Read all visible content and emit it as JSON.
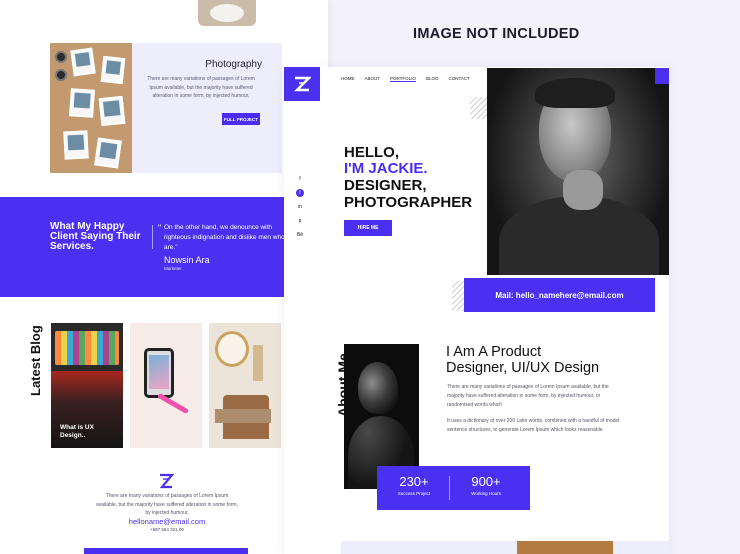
{
  "banner": {
    "text": "IMAGE NOT INCLUDED"
  },
  "left_page": {
    "project": {
      "title": "Photography",
      "text": "There are many variations of passages of Lorem Ipsum available, but the majority have suffered alteration in some form, by injected humour,",
      "button": "FULL PROJECT"
    },
    "testimonial": {
      "heading": "What My Happy Client Saying Their Services.",
      "quote": "On the other hand, we denounce with righteous indignation and dislike men who are.\"",
      "quote_mark": "\"",
      "name": "Nowsin Ara",
      "role": "Marketer"
    },
    "blog": {
      "section_label": "Latest Blog",
      "posts": [
        {
          "title": "What is UX Design.."
        }
      ]
    },
    "footer": {
      "text": "There are many variations of passages of Lorem Ipsum available, but the majority have suffered alteration in some form, by injected humour,",
      "email": "helloname@email.com",
      "phone": "+987 654 321 00"
    }
  },
  "right_page": {
    "nav": [
      "HOME",
      "ABOUT",
      "PORTFOLIO",
      "BLOG",
      "CONTACT"
    ],
    "nav_active": "PORTFOLIO",
    "social_icons": [
      {
        "name": "facebook-icon",
        "glyph": "f"
      },
      {
        "name": "twitter-icon",
        "glyph": "t"
      },
      {
        "name": "linkedin-icon",
        "glyph": "in"
      },
      {
        "name": "pinterest-icon",
        "glyph": "p"
      },
      {
        "name": "behance-icon",
        "glyph": "Bē"
      }
    ],
    "hero": {
      "line1": "HELLO,",
      "line2": "I'M JACKIE.",
      "line3": "DESIGNER,",
      "line4": "PHOTOGRAPHER",
      "button": "HIRE ME"
    },
    "contact_email": "Mail: hello_namehere@email.com",
    "about": {
      "section_label": "About Me",
      "title_line1": "I Am A Product",
      "title_line2": "Designer, UI/UX Design",
      "p1": "There are many variations of passages of Lorem Ipsum available, but the majority have suffered alteration in some form, by injected humour, or randomised words which",
      "p2": "It uses a dictionary of over 200 Latin words, combined with a handful of model sentence structures, to generate Lorem Ipsum which looks reasonable."
    },
    "stats": [
      {
        "value": "230+",
        "label": "Success Project"
      },
      {
        "value": "900+",
        "label": "Working Hours"
      }
    ]
  },
  "colors": {
    "accent": "#4b30f2",
    "background": "#f3f2fb"
  }
}
